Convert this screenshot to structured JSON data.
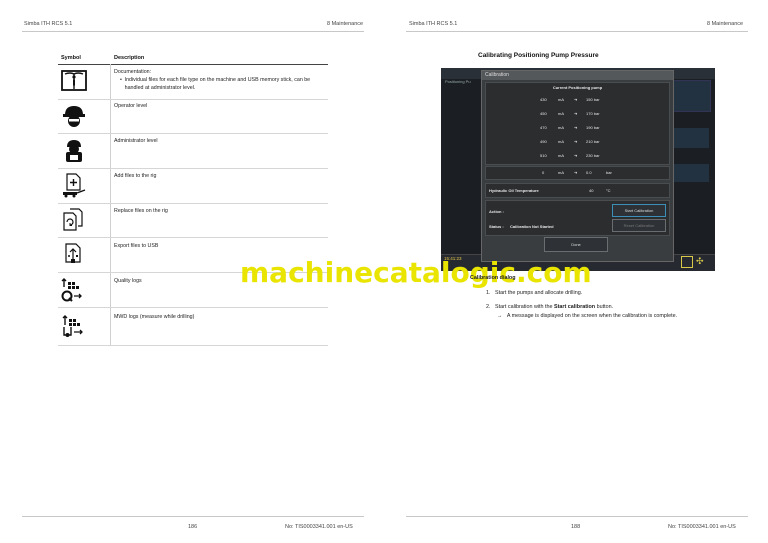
{
  "header": {
    "left_product": "Simba ITH RCS 5.1",
    "left_section": "8 Maintenance",
    "right_product": "Simba ITH RCS 5.1",
    "right_section": "8 Maintenance"
  },
  "table": {
    "col_symbol": "Symbol",
    "col_description": "Description",
    "rows": [
      {
        "icon": "documentation-book-icon",
        "title": "Documentation:",
        "bullet": "Individual files for each file type on the machine and USB memory stick, can be handled at administrator level."
      },
      {
        "icon": "operator-helmet-icon",
        "title": "Operator level"
      },
      {
        "icon": "administrator-icon",
        "title": "Administrator level"
      },
      {
        "icon": "add-files-rig-icon",
        "title": "Add files to the rig"
      },
      {
        "icon": "replace-files-rig-icon",
        "title": "Replace files on the rig"
      },
      {
        "icon": "export-usb-icon",
        "title": "Export files to USB"
      },
      {
        "icon": "quality-logs-icon",
        "title": "Quality logs"
      },
      {
        "icon": "mwd-logs-icon",
        "title": "MWD logs (measure while drilling)"
      }
    ]
  },
  "right": {
    "section_title": "Calibrating Positioning Pump Pressure",
    "screen": {
      "dialog_title": "Calibration",
      "bg_label_1": "Positioning Pu",
      "panel_title": "Current Positioning pump",
      "rows": [
        {
          "ma": "430",
          "unit": "mA",
          "bar": "150 bar"
        },
        {
          "ma": "450",
          "unit": "mA",
          "bar": "170 bar"
        },
        {
          "ma": "470",
          "unit": "mA",
          "bar": "190 bar"
        },
        {
          "ma": "490",
          "unit": "mA",
          "bar": "210 bar"
        },
        {
          "ma": "510",
          "unit": "mA",
          "bar": "230 bar"
        }
      ],
      "current_row": {
        "ma": "0",
        "unit": "mA",
        "value": "0.0",
        "bar_unit": "bar"
      },
      "oil_temp_label": "Hydraulic Oil Temperature",
      "oil_temp_value": "40",
      "oil_temp_unit": "°C",
      "action_label": "Action :",
      "status_label": "Status :",
      "status_value": "Calibration Not Started",
      "start_button": "Start Calibration",
      "reset_button": "Reset Calibration",
      "done_button": "Done",
      "clock": "15:41:23"
    },
    "watermark": "machinecatalogic.com",
    "intro_tail": "Calibration dialog",
    "steps": [
      {
        "num": "1.",
        "text": "Start the pumps and allocate drilling."
      },
      {
        "num": "2.",
        "text_pre": "Start calibration with the ",
        "text_bold": "Start calibration",
        "text_post": " button."
      }
    ],
    "result": "A message is displayed on the screen when the calibration is complete."
  },
  "footer": {
    "left_page": "186",
    "left_doc": "No: TIS0003341.001 en-US",
    "right_page": "188",
    "right_doc": "No: TIS0003341.001 en-US"
  }
}
